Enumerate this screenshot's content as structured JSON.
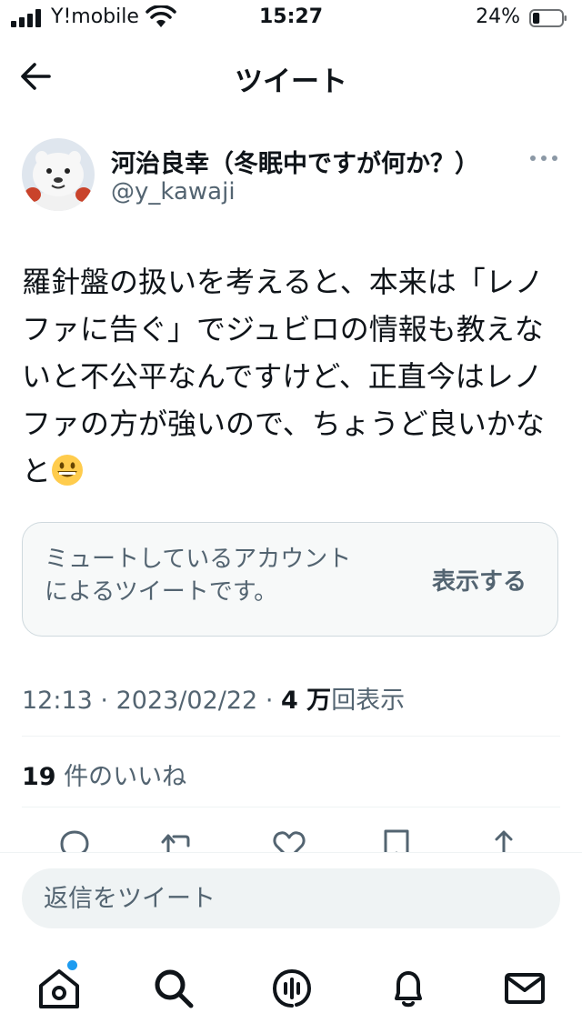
{
  "status_bar": {
    "carrier": "Y!mobile",
    "time": "15:27",
    "battery_percent": "24%",
    "battery_level": 0.24
  },
  "header": {
    "title": "ツイート",
    "back_icon": "arrow-left-icon"
  },
  "author": {
    "name": "河治良幸（冬眠中ですが何か？）",
    "handle": "@y_kawaji",
    "more_icon": "more-horizontal-icon"
  },
  "tweet": {
    "lines": [
      "羅針盤の扱いを考えると、本来は「レノ",
      "ファに告ぐ」でジュビロの情報も教えな",
      "いと不公平なんですけど、正直今はレノ",
      "ファの方が強いので、ちょうど良いかな",
      "と"
    ],
    "emoji": "grinning-face-emoji"
  },
  "muted_card": {
    "lines": [
      "ミュートしているアカウント",
      "によるツイートです。"
    ],
    "show_label": "表示する"
  },
  "meta": {
    "time": "12:13",
    "date": "2023/02/22",
    "views_count": "4 万",
    "views_label": "回表示",
    "separator": "·"
  },
  "likes": {
    "count": "19",
    "label": "件のいいね"
  },
  "actions": [
    "reply-icon",
    "retweet-icon",
    "like-icon",
    "bookmark-icon",
    "share-icon"
  ],
  "reply": {
    "placeholder": "返信をツイート"
  },
  "bottom_nav": {
    "items": [
      "home-icon",
      "search-icon",
      "spaces-icon",
      "notifications-icon",
      "messages-icon"
    ],
    "home_has_badge": true
  },
  "colors": {
    "text": "#0f1419",
    "secondary": "#536471",
    "accent": "#1d9bf0",
    "card_bg": "#f7f9f9",
    "border": "#cfd9de"
  }
}
